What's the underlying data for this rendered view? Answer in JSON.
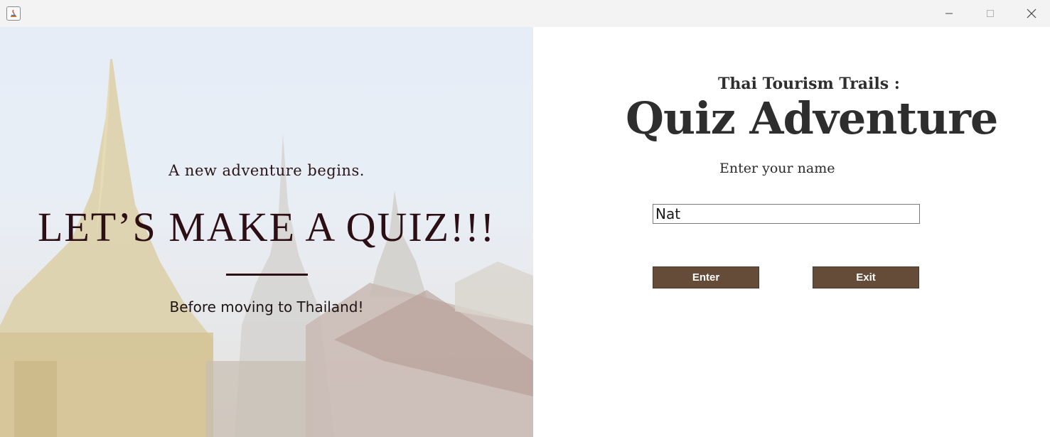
{
  "window": {
    "app_icon": "java-icon",
    "controls": {
      "minimize": "minimize-icon",
      "maximize": "maximize-icon",
      "close": "close-icon"
    }
  },
  "left": {
    "tagline": "A new adventure begins.",
    "headline": "LET’S MAKE A QUIZ!!!",
    "subline": "Before moving to Thailand!"
  },
  "right": {
    "subtitle": "Thai Tourism Trails :",
    "title": "Quiz Adventure",
    "prompt": "Enter your name",
    "name_value": "Nat",
    "enter_label": "Enter",
    "exit_label": "Exit"
  },
  "colors": {
    "button_bg": "#654c38",
    "headline": "#2b0f15",
    "title": "#2e2e2e"
  }
}
